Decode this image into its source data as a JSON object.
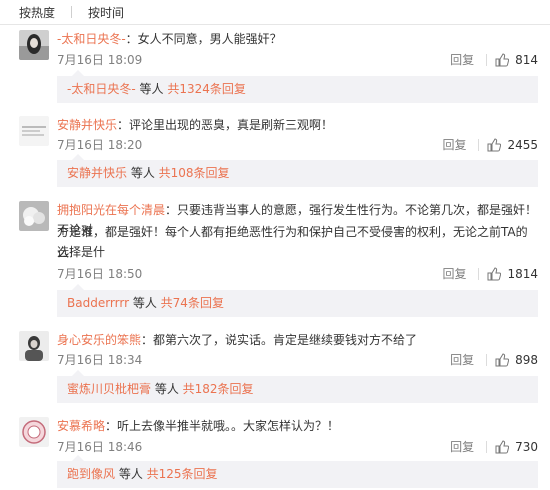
{
  "tabs": [
    "按热度",
    "按时间"
  ],
  "comments": [
    {
      "user": "-太和日央冬-",
      "text": "：女人不同意，男人能强奸？",
      "lines": [
        "：女人不同意，男人能强奸？"
      ],
      "date": "7月16日 18:09",
      "reply": "回复",
      "likes": "814",
      "sub_user": "-太和日央冬-",
      "sub_mid": " 等人 ",
      "sub_count": "共1324条回复"
    },
    {
      "user": "安静并快乐",
      "text": "：评论里出现的恶臭，真是刷新三观啊！",
      "lines": [
        "：评论里出现的恶臭，真是刷新三观啊！"
      ],
      "date": "7月16日 18:20",
      "reply": "回复",
      "likes": "2455",
      "sub_user": "安静并快乐",
      "sub_mid": " 等人 ",
      "sub_count": "共108条回复"
    },
    {
      "user": "拥抱阳光在每个清晨",
      "lines": [
        "：只要违背当事人的意愿，强行发生性行为。不论第几次，都是强奸！不论对",
        "方是谁，都是强奸！每个人都有拒绝恶性行为和保护自己不受侵害的权利，无论之前TA的选择是什",
        "么!"
      ],
      "date": "7月16日 18:50",
      "reply": "回复",
      "likes": "1814",
      "sub_user": "Badderrrrr",
      "sub_mid": " 等人 ",
      "sub_count": "共74条回复"
    },
    {
      "user": "身心安乐的笨熊",
      "lines": [
        "：都第六次了，说实话。肯定是继续要钱对方不给了"
      ],
      "date": "7月16日 18:34",
      "reply": "回复",
      "likes": "898",
      "sub_user": "蜜炼川贝枇杷膏",
      "sub_mid": " 等人 ",
      "sub_count": "共182条回复"
    },
    {
      "user": "安慕希略",
      "lines": [
        "：听上去像半推半就哦。。大家怎样认为？！"
      ],
      "date": "7月16日 18:46",
      "reply": "回复",
      "likes": "730",
      "sub_user": "跑到像风",
      "sub_mid": " 等人 ",
      "sub_count": "共125条回复"
    }
  ],
  "colors": {
    "username": "#eb7350",
    "text": "#333333",
    "meta": "#808080",
    "subbg": "#f2f2f5"
  },
  "icons": {
    "like": "thumbs-up-icon"
  }
}
